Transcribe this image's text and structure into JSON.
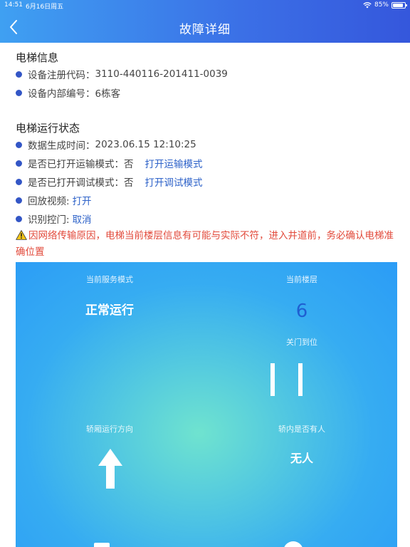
{
  "status_bar": {
    "time": "14:51",
    "date": "6月16日周五",
    "battery": "85%"
  },
  "header": {
    "title": "故障详细"
  },
  "elevator_info": {
    "title": "电梯信息",
    "reg_code_label": "设备注册代码：",
    "reg_code_value": "3110-440116-201411-0039",
    "internal_no_label": "设备内部编号：",
    "internal_no_value": "6栋客"
  },
  "run_status": {
    "title": "电梯运行状态",
    "data_time_label": "数据生成时间：",
    "data_time_value": "2023.06.15 12:10:25",
    "transport_label": "是否已打开运输模式：",
    "transport_value": "否",
    "transport_link": "打开运输模式",
    "debug_label": "是否已打开调试模式：",
    "debug_value": "否",
    "debug_link": "打开调试模式",
    "playback_label": "回放视频:",
    "playback_link": "打开",
    "door_control_label": "识别控门:",
    "door_control_link": "取消"
  },
  "warning": {
    "text": "因网络传输原因，电梯当前楼层信息有可能与实际不符，进入井道前，务必确认电梯准确位置"
  },
  "panel": {
    "service_mode_label": "当前服务模式",
    "service_mode_value": "正常运行",
    "floor_label": "当前楼层",
    "floor_value": "6",
    "door_label": "关门到位",
    "direction_label": "轿厢运行方向",
    "occupancy_label": "轿内是否有人",
    "occupancy_value": "无人"
  },
  "colors": {
    "header_start": "#3fa0f2",
    "header_end": "#3557dc",
    "bullet": "#3356c6",
    "link": "#2f63c9",
    "warning": "#e24a3b",
    "floor": "#1f5fd1"
  },
  "icons": [
    "back-chevron-icon",
    "wifi-icon",
    "battery-icon",
    "warning-icon",
    "door-closed-icon",
    "arrow-up-icon"
  ]
}
